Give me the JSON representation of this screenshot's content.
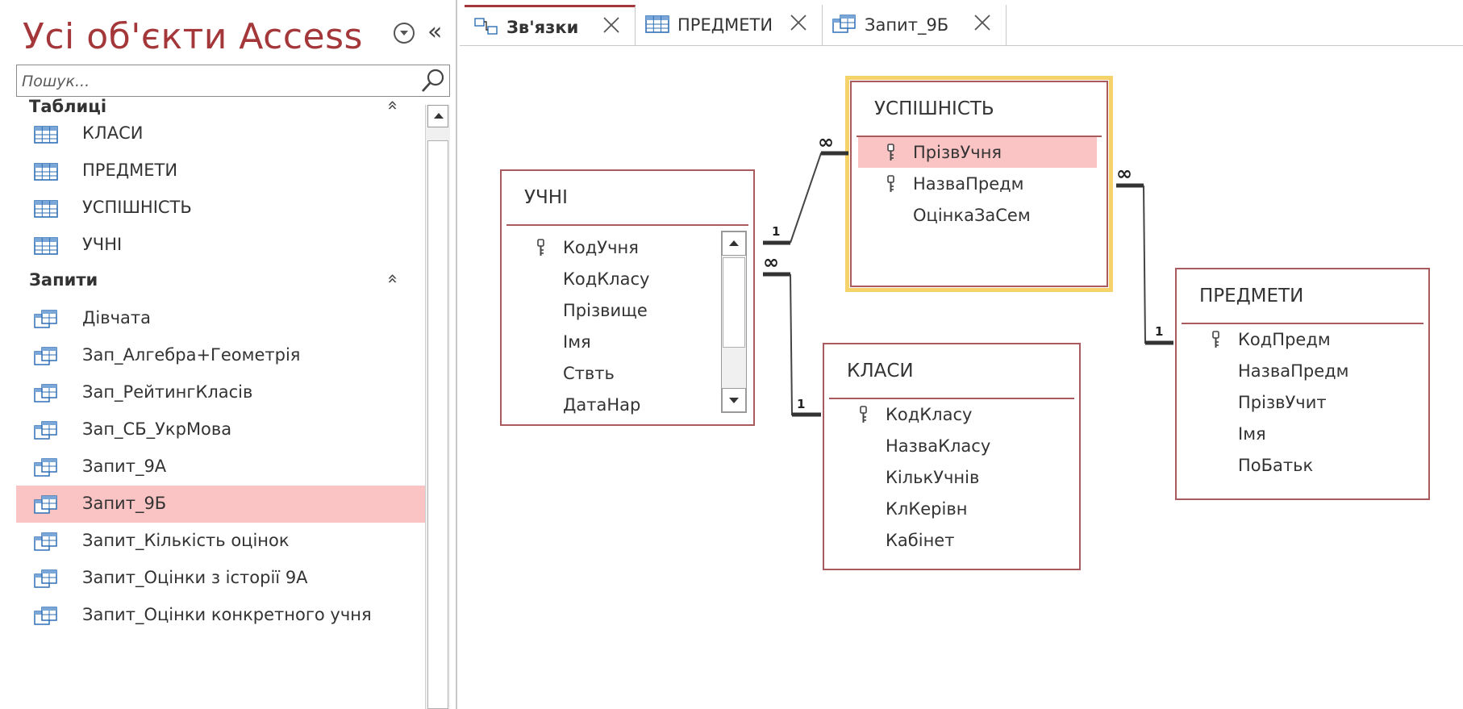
{
  "nav": {
    "title": "Усі об'єкти Access",
    "search_placeholder": "Пошук...",
    "groups": [
      {
        "label": "Таблиці",
        "items": [
          "КЛАСИ",
          "ПРЕДМЕТИ",
          "УСПІШНІСТЬ",
          "УЧНІ"
        ]
      },
      {
        "label": "Запити",
        "items": [
          "Дівчата",
          "Зап_Алгебра+Геометрія",
          "Зап_РейтингКласів",
          "Зап_СБ_УкрМова",
          "Запит_9А",
          "Запит_9Б",
          "Запит_Кількість оцінок",
          "Запит_Оцінки з історії 9А",
          "Запит_Оцінки конкретного учня"
        ]
      }
    ],
    "selected_item": "Запит_9Б"
  },
  "tabs": [
    {
      "label": "Зв'язки",
      "icon": "relationships-icon",
      "active": true
    },
    {
      "label": "ПРЕДМЕТИ",
      "icon": "table-icon",
      "active": false
    },
    {
      "label": "Запит_9Б",
      "icon": "query-icon",
      "active": false
    }
  ],
  "tables": {
    "uchni": {
      "title": "УЧНІ",
      "fields": [
        {
          "name": "КодУчня",
          "key": true
        },
        {
          "name": "КодКласу",
          "key": false
        },
        {
          "name": "Прізвище",
          "key": false
        },
        {
          "name": "Імя",
          "key": false
        },
        {
          "name": "Ствть",
          "key": false
        },
        {
          "name": "ДатаНар",
          "key": false
        }
      ]
    },
    "uspishnist": {
      "title": "УСПІШНІСТЬ",
      "fields": [
        {
          "name": "ПрізвУчня",
          "key": true
        },
        {
          "name": "НазваПредм",
          "key": true
        },
        {
          "name": "ОцінкаЗаСем",
          "key": false
        }
      ]
    },
    "klasy": {
      "title": "КЛАСИ",
      "fields": [
        {
          "name": "КодКласу",
          "key": true
        },
        {
          "name": "НазваКласу",
          "key": false
        },
        {
          "name": "КількУчнів",
          "key": false
        },
        {
          "name": "КлКерівн",
          "key": false
        },
        {
          "name": "Кабінет",
          "key": false
        }
      ]
    },
    "predmety": {
      "title": "ПРЕДМЕТИ",
      "fields": [
        {
          "name": "КодПредм",
          "key": true
        },
        {
          "name": "НазваПредм",
          "key": false
        },
        {
          "name": "ПрізвУчит",
          "key": false
        },
        {
          "name": "Імя",
          "key": false
        },
        {
          "name": "ПоБатьк",
          "key": false
        }
      ]
    }
  },
  "relations": {
    "one": "1",
    "many": "∞"
  },
  "colors": {
    "accent": "#a4373a",
    "selection": "#fbc4c4",
    "table_border": "#a85a5c",
    "selected_outline": "#f5d26a",
    "slide_green": "#8ab83a"
  }
}
